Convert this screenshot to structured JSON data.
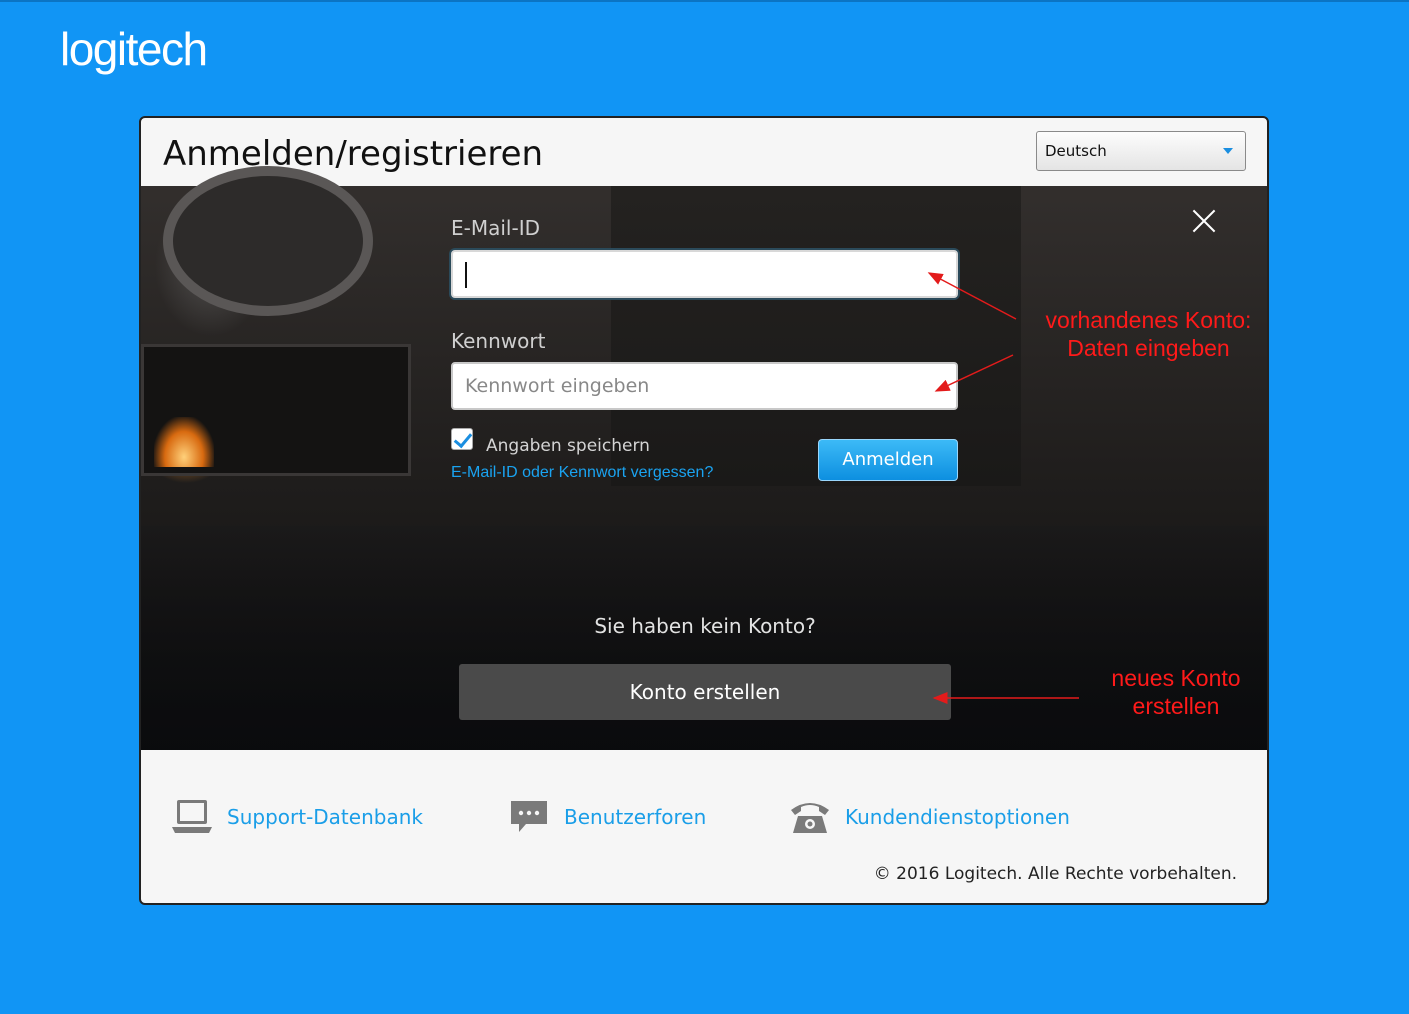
{
  "brand": {
    "logo_text": "logitech"
  },
  "dialog": {
    "title": "Anmelden/registrieren",
    "language": {
      "selected": "Deutsch"
    }
  },
  "form": {
    "email_label": "E-Mail-ID",
    "email_value": "",
    "password_label": "Kennwort",
    "password_placeholder": "Kennwort eingeben",
    "remember_label": "Angaben speichern",
    "remember_checked": true,
    "forgot_link": "E-Mail-ID oder Kennwort vergessen?",
    "login_button": "Anmelden"
  },
  "signup": {
    "prompt": "Sie haben kein Konto?",
    "create_button": "Konto erstellen"
  },
  "annotations": {
    "existing_line1": "vorhandenes Konto:",
    "existing_line2": "Daten eingeben",
    "new_line1": "neues Konto",
    "new_line2": "erstellen",
    "color": "#ff1a1a"
  },
  "footer": {
    "links": [
      {
        "label": "Support-Datenbank",
        "icon": "laptop-icon"
      },
      {
        "label": "Benutzerforen",
        "icon": "chat-bubble-icon"
      },
      {
        "label": "Kundendienstoptionen",
        "icon": "telephone-icon"
      }
    ],
    "copyright": "© 2016 Logitech. Alle Rechte vorbehalten."
  },
  "colors": {
    "background": "#1195f5",
    "accent": "#1a9ee8",
    "button": "#0d8fe0"
  }
}
